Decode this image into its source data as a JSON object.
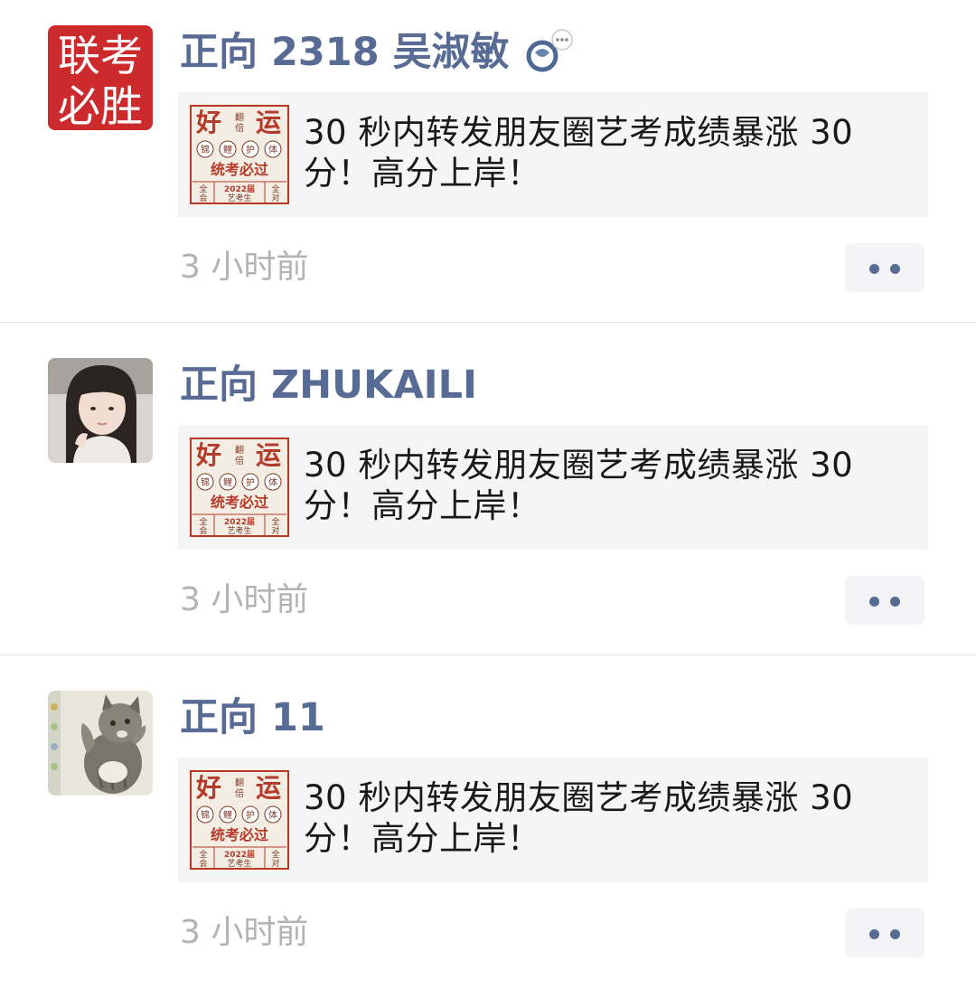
{
  "posts": [
    {
      "username": "正向 2318 吴淑敏",
      "avatar": "联考必胜-avatar",
      "avatar_text_line1": "联考",
      "avatar_text_line2": "必胜",
      "has_status_badge": true,
      "link": {
        "thumb": "lucky-charm-thumbnail",
        "title": "30 秒内转发朋友圈艺考成绩暴涨 30 分！高分上岸！"
      },
      "time": "3 小时前"
    },
    {
      "username": "正向 ZHUKAILI",
      "avatar": "girl-photo-avatar",
      "link": {
        "thumb": "lucky-charm-thumbnail",
        "title": "30 秒内转发朋友圈艺考成绩暴涨 30 分！高分上岸！"
      },
      "time": "3 小时前"
    },
    {
      "username": "正向 11",
      "avatar": "cat-photo-avatar",
      "link": {
        "thumb": "lucky-charm-thumbnail",
        "title": "30 秒内转发朋友圈艺考成绩暴涨 30 分！高分上岸！"
      },
      "time": "3 小时前"
    }
  ],
  "thumb_text": {
    "big1": "好",
    "big2": "运",
    "small_right1": "翻",
    "small_right2": "倍",
    "badge1": "锦",
    "badge2": "鲤",
    "badge3": "护",
    "badge4": "体",
    "banner": "统考必过",
    "corner_left1": "全",
    "corner_left2": "会",
    "corner_right1": "全",
    "corner_right2": "对",
    "year": "2022届",
    "sub": "艺考生"
  },
  "colors": {
    "username": "#576b95",
    "timestamp": "#b3b3b3",
    "card_bg": "#f5f5f5",
    "avatar_red": "#cc2a2c",
    "thumb_red": "#b53a2a"
  }
}
